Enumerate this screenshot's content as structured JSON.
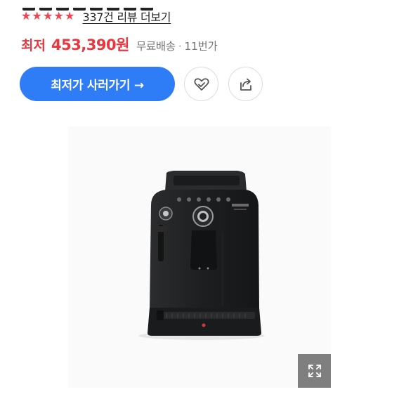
{
  "rating": {
    "stars": [
      "★",
      "★",
      "★",
      "★",
      "★"
    ],
    "star_color": "#f2434f",
    "review_link": "337건 리뷰 더보기"
  },
  "price": {
    "label": "최저",
    "value": "453,390원",
    "shipping": "무료배송",
    "separator": "·",
    "sellers": "11번가",
    "color": "#e8373e"
  },
  "actions": {
    "cta_label": "최저가 사러가기 →",
    "cta_color": "#2e7cf6",
    "like_icon": "heart-icon",
    "share_icon": "share-icon"
  },
  "image": {
    "subject": "coffee-machine",
    "expand_icon": "expand-icon"
  }
}
